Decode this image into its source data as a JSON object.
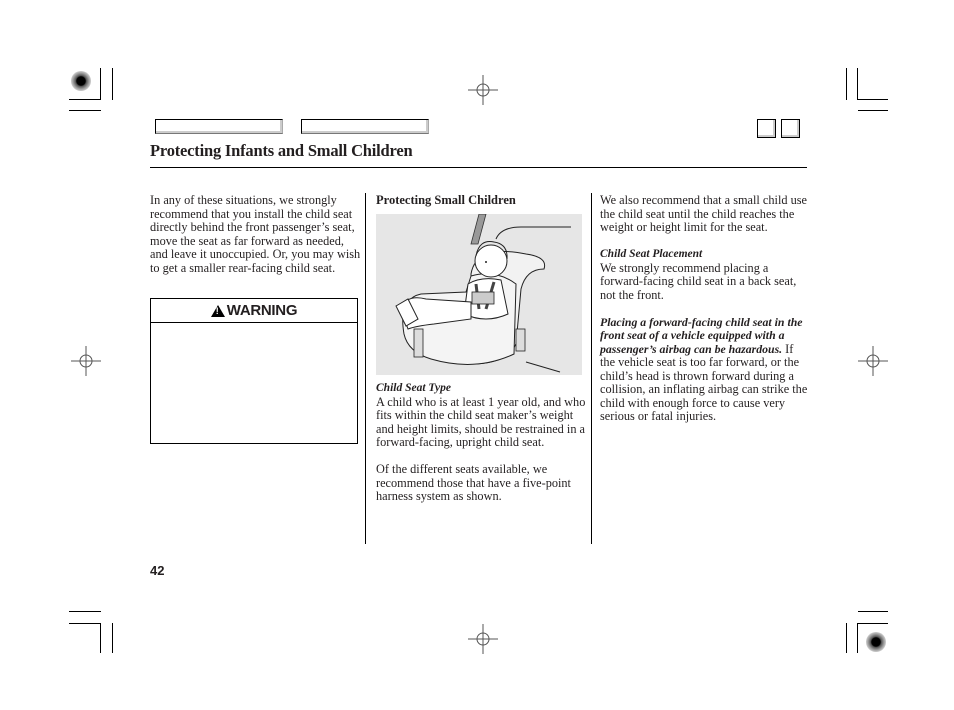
{
  "page": {
    "title": "Protecting Infants and Small Children",
    "page_number": "42"
  },
  "nav": {
    "buttons": [
      {
        "label": ""
      },
      {
        "label": ""
      }
    ],
    "square_buttons": [
      {
        "label": ""
      },
      {
        "label": ""
      }
    ]
  },
  "column1": {
    "paragraph": "In any of these situations, we strongly recommend that you install the child seat directly behind the front passenger’s seat, move the seat as far forward as needed, and leave it unoccupied. Or, you may wish to get a smaller rear-facing child seat.",
    "warning": {
      "icon": "warning-triangle-icon",
      "label": "WARNING",
      "body": ""
    }
  },
  "column2": {
    "heading": "Protecting Small Children",
    "figure": {
      "description": "Illustration of a small child secured in a forward-facing child seat with a five-point harness",
      "background": "#e6e6e6"
    },
    "subheading": "Child Seat Type",
    "paragraph1": "A child who is at least 1 year old, and who fits within the child seat maker’s weight and height limits, should be restrained in a forward-facing, upright child seat.",
    "paragraph2": "Of the different seats available, we recommend those that have a five-point harness system as shown."
  },
  "column3": {
    "paragraph1": "We also recommend that a small child use the child seat until the child reaches the weight or height limit for the seat.",
    "subheading": "Child Seat Placement",
    "paragraph2": "We strongly recommend placing a forward-facing child seat in a back seat, not the front.",
    "warning_bold": "Placing a forward-facing child seat in the front seat of a vehicle equipped with a passenger’s airbag can be hazardous.",
    "warning_rest": " If the vehicle seat is too far forward, or the child’s head is thrown forward during a collision, an inflating airbag can strike the child with enough force to cause very serious or fatal injuries."
  }
}
